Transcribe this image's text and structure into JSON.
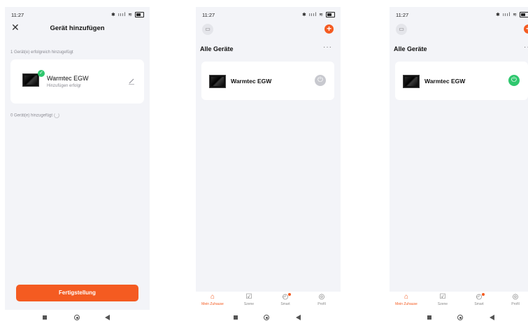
{
  "status_bar": {
    "time": "11:27",
    "icons": "✱ ıııl ≋"
  },
  "screen1": {
    "title": "Gerät hinzufügen",
    "added_success_label": "1 Gerät(e) erfolgreich hinzugefügt",
    "device": {
      "name": "Warmtec EGW",
      "subtitle": "Hinzufügen erfolgr"
    },
    "adding_label": "0 Gerät(e) hinzugefügt",
    "finish_button": "Fertigstellung"
  },
  "screen2": {
    "section_title": "Alle Geräte",
    "more": "···",
    "device": {
      "name": "Warmtec EGW",
      "power_state": "off"
    }
  },
  "screen3": {
    "section_title": "Alle Geräte",
    "more": "···",
    "device": {
      "name": "Warmtec EGW",
      "power_state": "on"
    }
  },
  "tabbar": {
    "tabs": [
      {
        "label": "Mein Zuhause",
        "icon": "home-icon",
        "active": true
      },
      {
        "label": "Szene",
        "icon": "checkbox-icon",
        "active": false
      },
      {
        "label": "Smart",
        "icon": "smart-icon",
        "active": false,
        "badge": true
      },
      {
        "label": "Profil",
        "icon": "profile-icon",
        "active": false
      }
    ]
  },
  "colors": {
    "accent": "#f45b21",
    "success": "#2fc76e",
    "background": "#f3f4f8"
  }
}
